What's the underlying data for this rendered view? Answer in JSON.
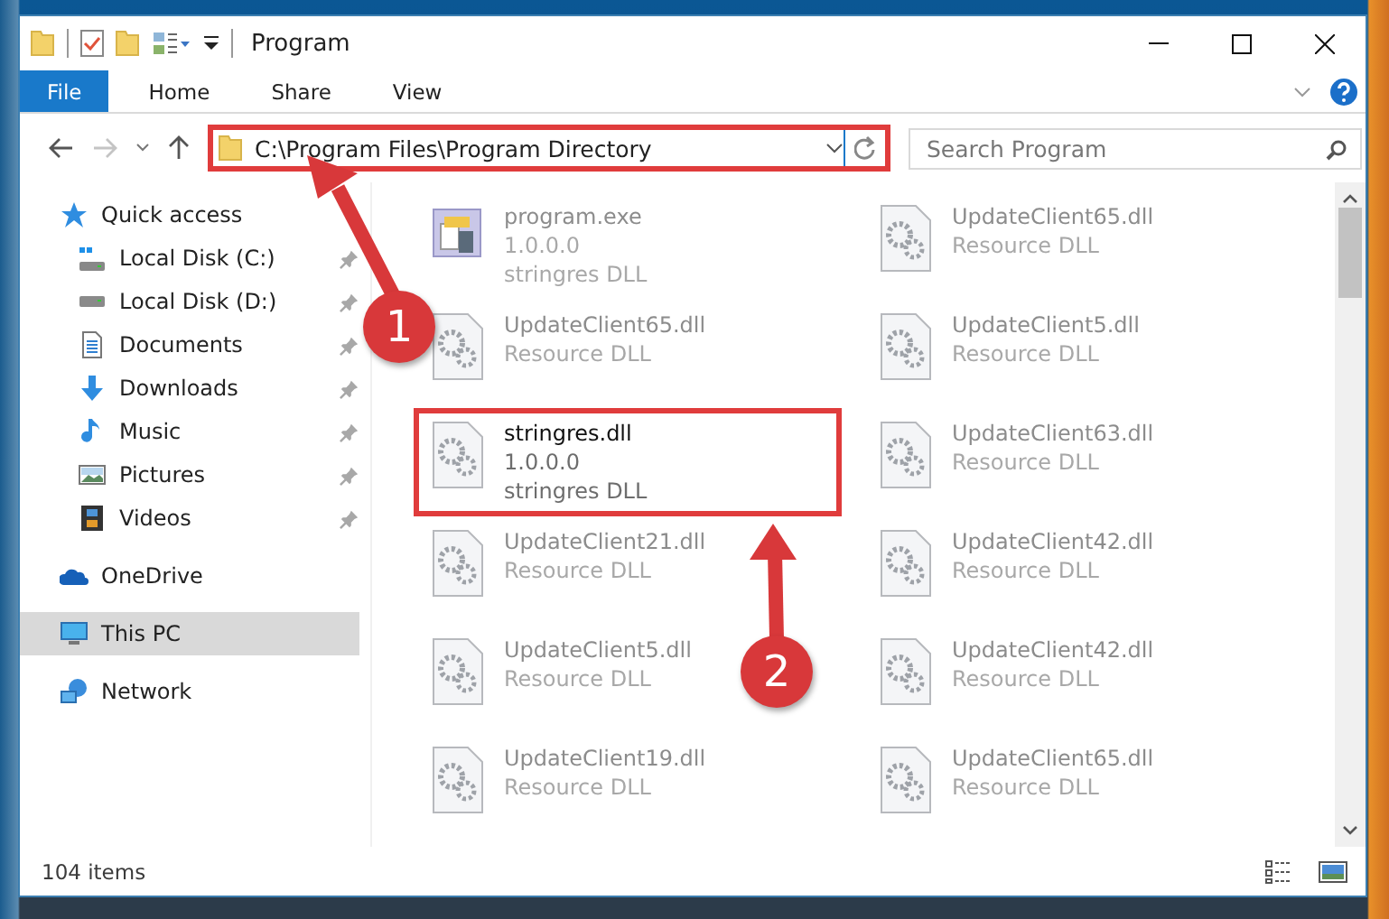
{
  "window": {
    "title": "Program"
  },
  "ribbon_tabs": [
    {
      "label": "File",
      "selected": true
    },
    {
      "label": "Home",
      "selected": false
    },
    {
      "label": "Share",
      "selected": false
    },
    {
      "label": "View",
      "selected": false
    }
  ],
  "address": {
    "path": "C:\\Program Files\\Program Directory",
    "highlighted": true
  },
  "search": {
    "placeholder": "Search Program"
  },
  "sidebar": {
    "items": [
      {
        "label": "Quick access",
        "kind": "star",
        "selected": false,
        "children": [
          {
            "label": "Local Disk (C:)",
            "kind": "system-drive",
            "pinned": true,
            "selected": false
          },
          {
            "label": "Local Disk (D:)",
            "kind": "drive",
            "pinned": true,
            "selected": false
          },
          {
            "label": "Documents",
            "kind": "document",
            "pinned": true,
            "selected": false
          },
          {
            "label": "Downloads",
            "kind": "download",
            "pinned": true,
            "selected": false
          },
          {
            "label": "Music",
            "kind": "music",
            "pinned": true,
            "selected": false
          },
          {
            "label": "Pictures",
            "kind": "pictures",
            "pinned": true,
            "selected": false
          },
          {
            "label": "Videos",
            "kind": "video",
            "pinned": true,
            "selected": false
          }
        ]
      },
      {
        "label": "OneDrive",
        "kind": "cloud",
        "selected": false
      },
      {
        "label": "This PC",
        "kind": "computer",
        "selected": true
      },
      {
        "label": "Network",
        "kind": "network",
        "selected": false
      }
    ]
  },
  "files": [
    {
      "name": "program.exe",
      "details": [
        "1.0.0.0",
        "stringres DLL"
      ],
      "kind": "exe",
      "dimmed": true,
      "highlighted": false
    },
    {
      "name": "UpdateClient65.dll",
      "details": [
        "Resource DLL"
      ],
      "kind": "dll",
      "dimmed": true,
      "highlighted": false
    },
    {
      "name": "UpdateClient65.dll",
      "details": [
        "Resource DLL"
      ],
      "kind": "dll",
      "dimmed": true,
      "highlighted": false
    },
    {
      "name": "UpdateClient5.dll",
      "details": [
        "Resource DLL"
      ],
      "kind": "dll",
      "dimmed": true,
      "highlighted": false
    },
    {
      "name": "stringres.dll",
      "details": [
        "1.0.0.0",
        "stringres DLL"
      ],
      "kind": "dll",
      "dimmed": false,
      "highlighted": true
    },
    {
      "name": "UpdateClient63.dll",
      "details": [
        "Resource DLL"
      ],
      "kind": "dll",
      "dimmed": true,
      "highlighted": false
    },
    {
      "name": "UpdateClient21.dll",
      "details": [
        "Resource DLL"
      ],
      "kind": "dll",
      "dimmed": true,
      "highlighted": false
    },
    {
      "name": "UpdateClient42.dll",
      "details": [
        "Resource DLL"
      ],
      "kind": "dll",
      "dimmed": true,
      "highlighted": false
    },
    {
      "name": "UpdateClient5.dll",
      "details": [
        "Resource DLL"
      ],
      "kind": "dll",
      "dimmed": true,
      "highlighted": false
    },
    {
      "name": "UpdateClient42.dll",
      "details": [
        "Resource DLL"
      ],
      "kind": "dll",
      "dimmed": true,
      "highlighted": false
    },
    {
      "name": "UpdateClient19.dll",
      "details": [
        "Resource DLL"
      ],
      "kind": "dll",
      "dimmed": true,
      "highlighted": false
    },
    {
      "name": "UpdateClient65.dll",
      "details": [
        "Resource DLL"
      ],
      "kind": "dll",
      "dimmed": true,
      "highlighted": false
    }
  ],
  "status_bar": {
    "item_count": "104 items"
  },
  "callouts": [
    {
      "number": "1"
    },
    {
      "number": "2"
    }
  ]
}
